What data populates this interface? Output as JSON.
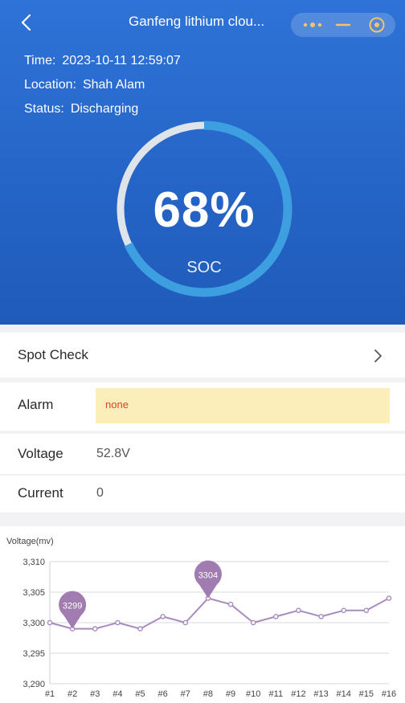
{
  "header": {
    "title": "Ganfeng lithium clou...",
    "time_label": "Time:",
    "time_value": "2023-10-11 12:59:07",
    "location_label": "Location:",
    "location_value": "Shah Alam",
    "status_label": "Status:",
    "status_value": "Discharging"
  },
  "gauge": {
    "value_text": "68%",
    "label": "SOC",
    "fraction": 0.68,
    "track_color": "#dfe3ea",
    "fill_color": "#3d9ee0"
  },
  "rows": {
    "spot_check_label": "Spot Check",
    "alarm_label": "Alarm",
    "alarm_value": "none",
    "voltage_label": "Voltage",
    "voltage_value": "52.8V",
    "current_label": "Current",
    "current_value": "0"
  },
  "chart_data": {
    "type": "line",
    "ylabel": "Voltage(mv)",
    "categories": [
      "#1",
      "#2",
      "#3",
      "#4",
      "#5",
      "#6",
      "#7",
      "#8",
      "#9",
      "#10",
      "#11",
      "#12",
      "#13",
      "#14",
      "#15",
      "#16"
    ],
    "series": [
      {
        "values": [
          3300,
          3299,
          3299,
          3300,
          3299,
          3301,
          3300,
          3304,
          3303,
          3300,
          3301,
          3302,
          3301,
          3302,
          3302,
          3304
        ]
      }
    ],
    "ylim": [
      3290,
      3310
    ],
    "yticks": [
      3290,
      3295,
      3300,
      3305,
      3310
    ],
    "ytick_labels": [
      "3,290",
      "3,295",
      "3,300",
      "3,305",
      "3,310"
    ],
    "markers": [
      {
        "category": "#2",
        "label": "3299"
      },
      {
        "category": "#8",
        "label": "3304"
      }
    ],
    "line_color": "#a98bbf",
    "marker_color": "#a07cb0",
    "grid": true
  }
}
